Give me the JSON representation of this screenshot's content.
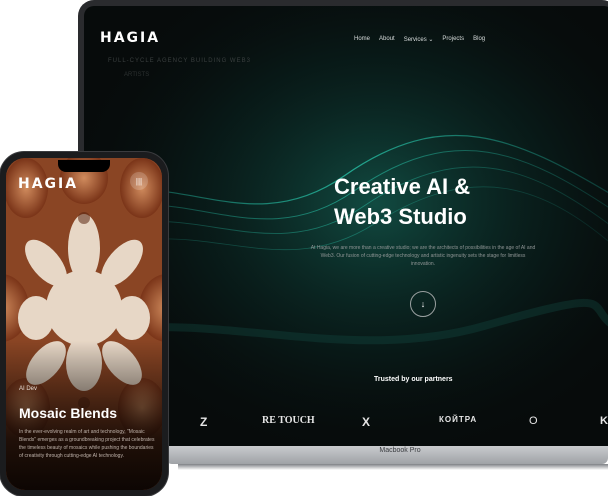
{
  "site": {
    "logo": "HAGIA",
    "ghost_line_1": "FULL-CYCLE AGENCY BUILDING WEB3",
    "ghost_line_2": "ARTISTS",
    "nav": [
      "Home",
      "About",
      "Services",
      "Projects",
      "Blog"
    ],
    "hero_title_line1": "Creative AI &",
    "hero_title_line2": "Web3 Studio",
    "hero_desc": "At Hagia, we are more than a creative studio; we are the architects of possibilities in the age of AI and Web3. Our fusion of cutting-edge technology and artistic ingenuity sets the stage for limitless innovation.",
    "scroll_icon": "arrow-down-icon",
    "partners_title": "Trusted by our partners",
    "partners": [
      "Z",
      "RE TOUCH",
      "X",
      "КОЙТРА",
      "O",
      "K"
    ]
  },
  "device": {
    "brand": "Macbook Pro"
  },
  "phone": {
    "logo": "HAGIA",
    "tag": "AI Dev",
    "title": "Mosaic Blends",
    "desc": "In the ever-evolving realm of art and technology, \"Mosaic Blends\" emerges as a groundbreaking project that celebrates the timeless beauty of mosaics while pushing the boundaries of creativity through cutting-edge AI technology."
  },
  "colors": {
    "accent_teal": "#19c2a6",
    "background_dark": "#070b0b",
    "mosaic_brown": "#b1643a",
    "mosaic_cream": "#e8d6c4"
  }
}
